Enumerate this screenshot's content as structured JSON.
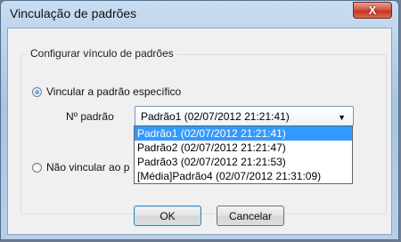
{
  "window": {
    "title": "Vinculação de padrões",
    "close_glyph": "X"
  },
  "group": {
    "label": "Configurar vínculo de padrões",
    "option_specific": "Vincular a padrão específico",
    "option_none": "Não vincular ao p",
    "field_label": "Nº padrão",
    "combo_value": "Padrão1 (02/07/2012 21:21:41)",
    "dropdown_items": [
      "Padrão1 (02/07/2012 21:21:41)",
      "Padrão2 (02/07/2012 21:21:47)",
      "Padrão3 (02/07/2012 21:21:53)",
      "[Média]Padrão4 (02/07/2012 21:31:09)"
    ]
  },
  "buttons": {
    "ok": "OK",
    "cancel": "Cancelar"
  }
}
